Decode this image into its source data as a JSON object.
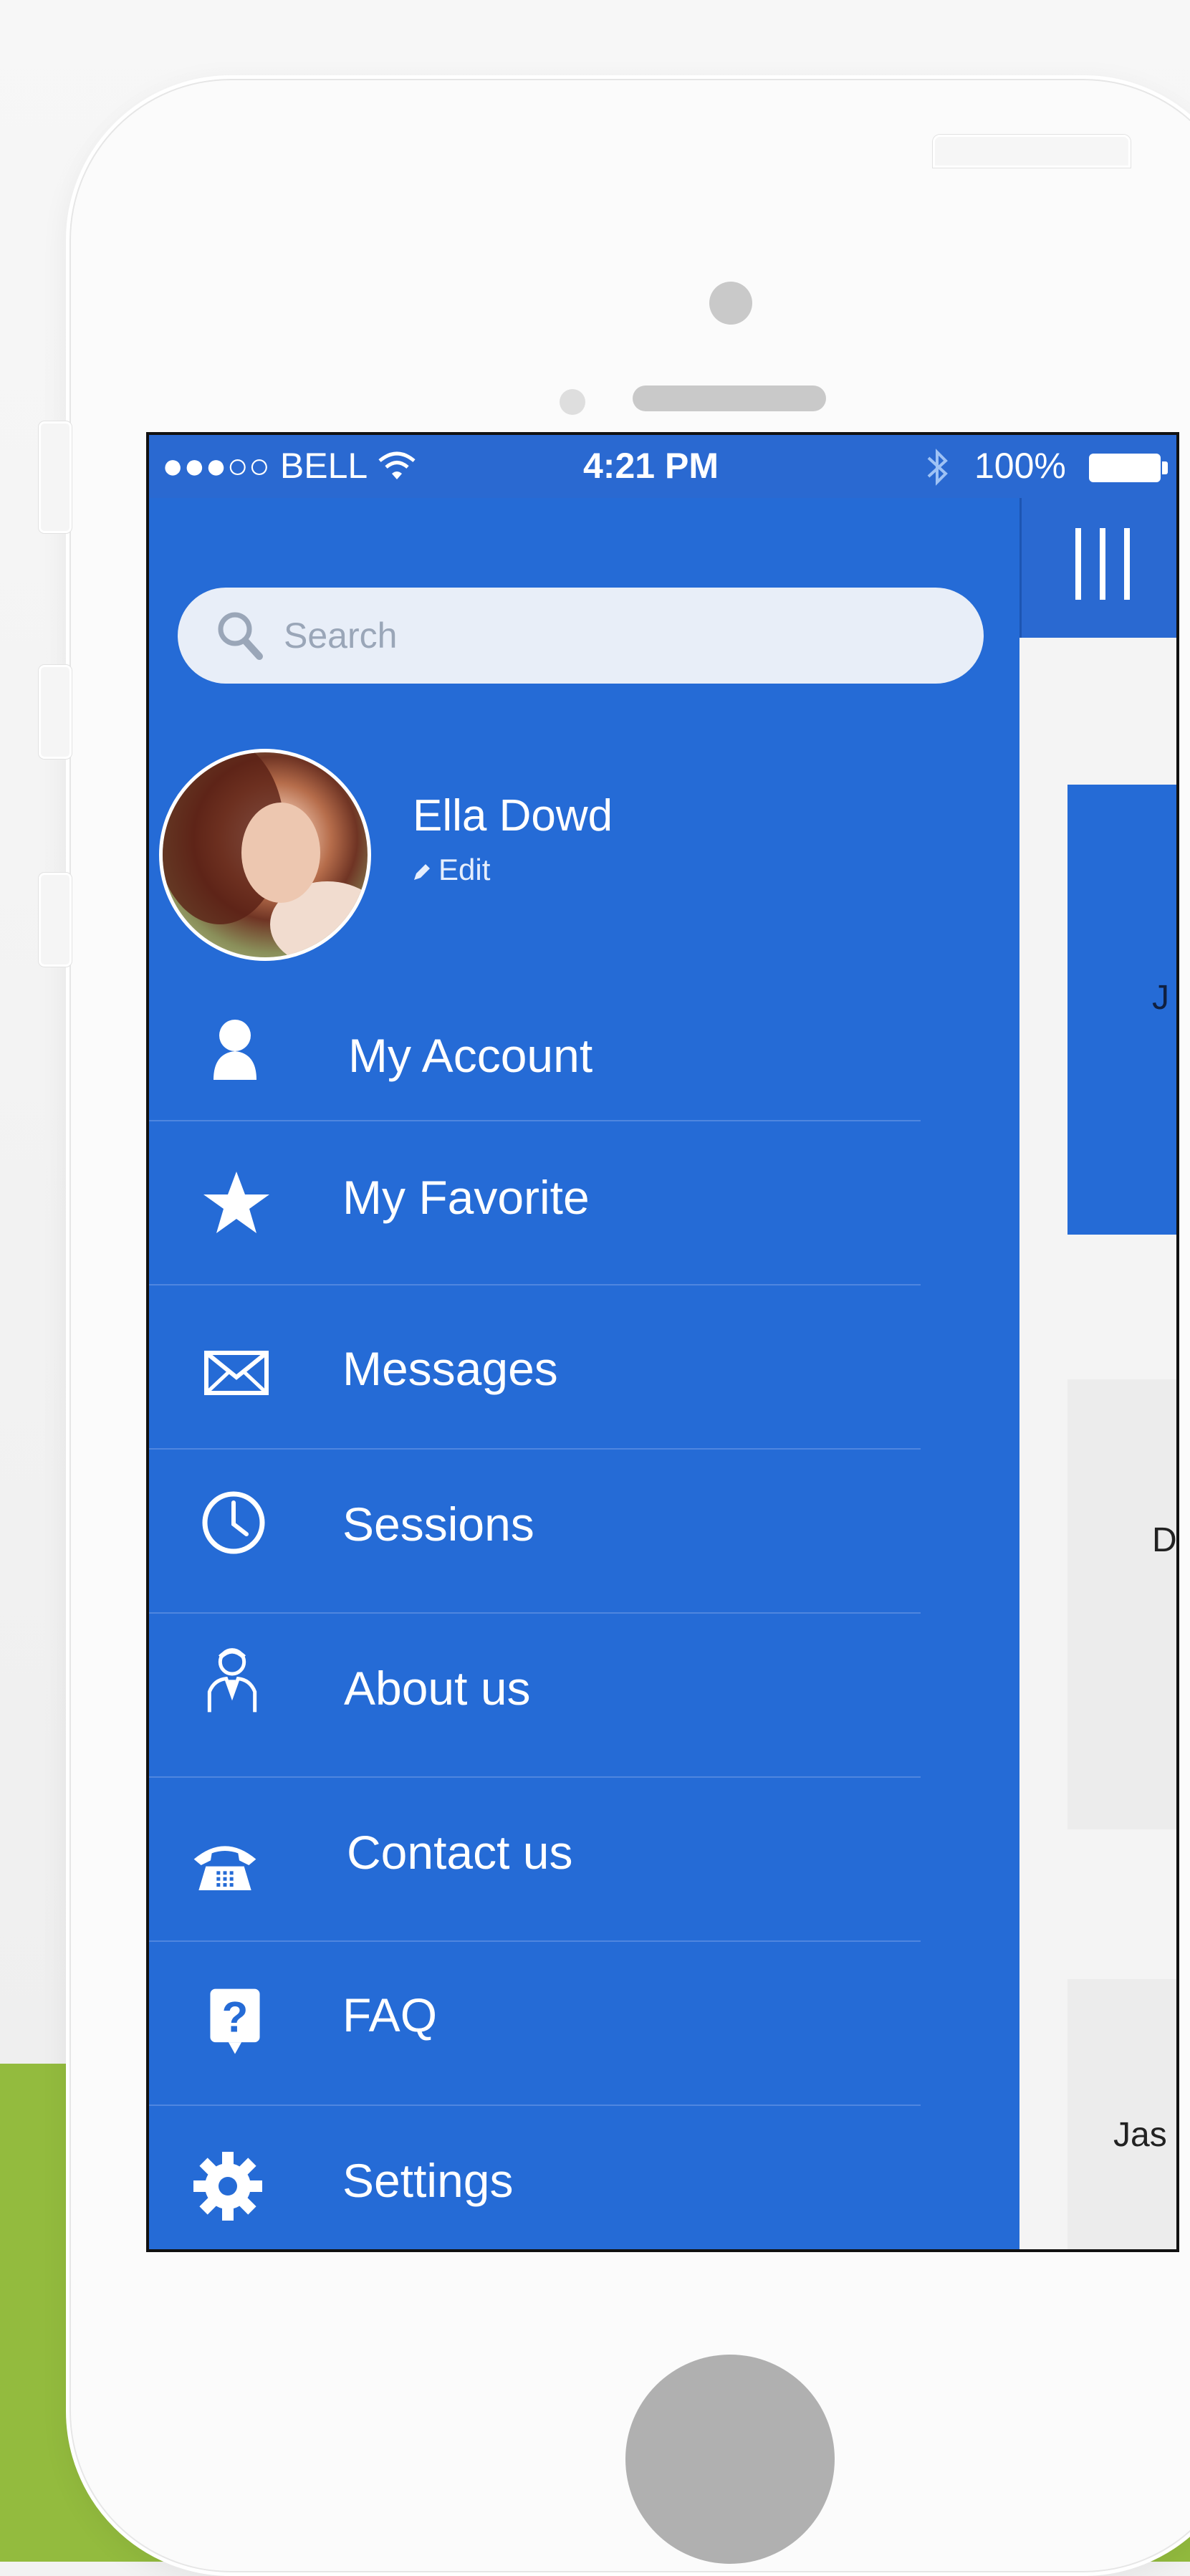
{
  "status_bar": {
    "carrier": "●●●○○ BELL",
    "time": "4:21 PM",
    "battery": "100%"
  },
  "search": {
    "placeholder": "Search"
  },
  "profile": {
    "name": "Ella Dowd",
    "edit_label": "Edit"
  },
  "menu": [
    {
      "label": "My Account",
      "icon": "user-icon"
    },
    {
      "label": "My Favorite",
      "icon": "star-icon"
    },
    {
      "label": "Messages",
      "icon": "envelope-icon"
    },
    {
      "label": "Sessions",
      "icon": "clock-icon"
    },
    {
      "label": "About us",
      "icon": "person-tie-icon"
    },
    {
      "label": "Contact us",
      "icon": "telephone-icon"
    },
    {
      "label": "FAQ",
      "icon": "question-icon"
    },
    {
      "label": "Settings",
      "icon": "gear-icon"
    }
  ],
  "content_peek": [
    "J",
    "D",
    "Jas"
  ],
  "colors": {
    "primary": "#256bd6",
    "background_accent": "#93bb3e"
  }
}
